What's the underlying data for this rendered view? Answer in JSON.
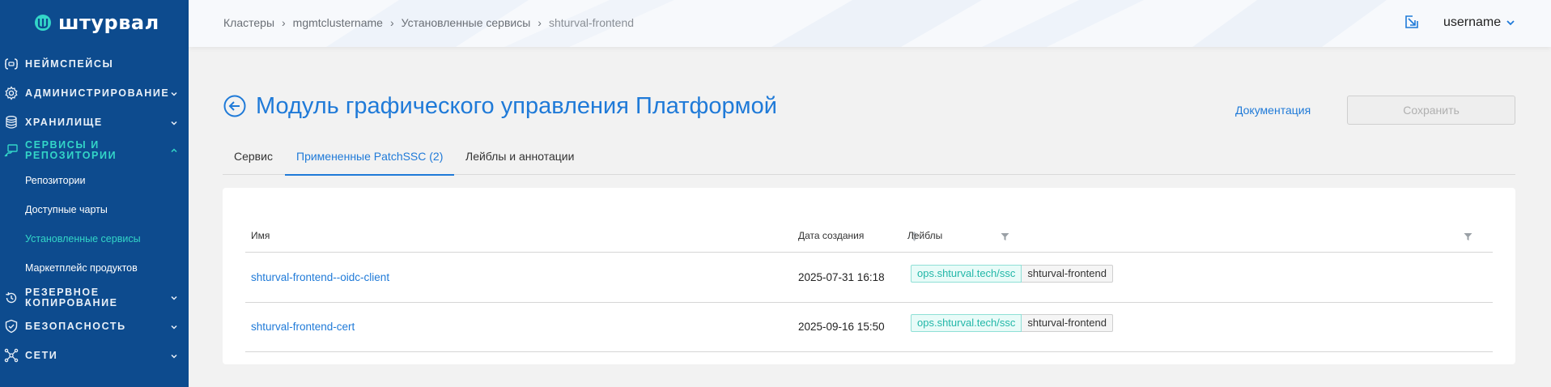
{
  "brand": {
    "name": "штурвал"
  },
  "sidebar": {
    "items": [
      {
        "label": "Неймспейсы",
        "icon": "namespaces-icon"
      },
      {
        "label": "Администрирование",
        "icon": "gear-icon"
      },
      {
        "label": "Хранилище",
        "icon": "database-icon"
      },
      {
        "label": "Сервисы и репозитории",
        "icon": "services-icon"
      },
      {
        "label": "Резервное копирование",
        "icon": "backup-icon"
      },
      {
        "label": "Безопасность",
        "icon": "shield-icon"
      },
      {
        "label": "Сети",
        "icon": "network-icon"
      }
    ],
    "sub_items": [
      {
        "label": "Репозитории"
      },
      {
        "label": "Доступные чарты"
      },
      {
        "label": "Установленные сервисы"
      },
      {
        "label": "Маркетплейс продуктов"
      }
    ]
  },
  "header": {
    "breadcrumb": [
      "Кластеры",
      "mgmtclustername",
      "Установленные сервисы",
      "shturval-frontend"
    ],
    "user": "username"
  },
  "page": {
    "title": "Модуль графического управления Платформой",
    "doc_link": "Документация",
    "save_label": "Сохранить"
  },
  "tabs": [
    {
      "label": "Сервис"
    },
    {
      "label": "Примененные PatchSSC (2)"
    },
    {
      "label": "Лейблы и аннотации"
    }
  ],
  "table": {
    "columns": [
      "Имя",
      "Дата создания",
      "Лейблы"
    ],
    "rows": [
      {
        "name": "shturval-frontend--oidc-client",
        "date": "2025-07-31 16:18",
        "label_key": "ops.shturval.tech/ssc",
        "label_value": "shturval-frontend"
      },
      {
        "name": "shturval-frontend-cert",
        "date": "2025-09-16 15:50",
        "label_key": "ops.shturval.tech/ssc",
        "label_value": "shturval-frontend"
      }
    ]
  },
  "colors": {
    "sidebar_bg": "#0d4b8e",
    "accent": "#1f7ad8",
    "active_teal": "#33d6c8"
  }
}
